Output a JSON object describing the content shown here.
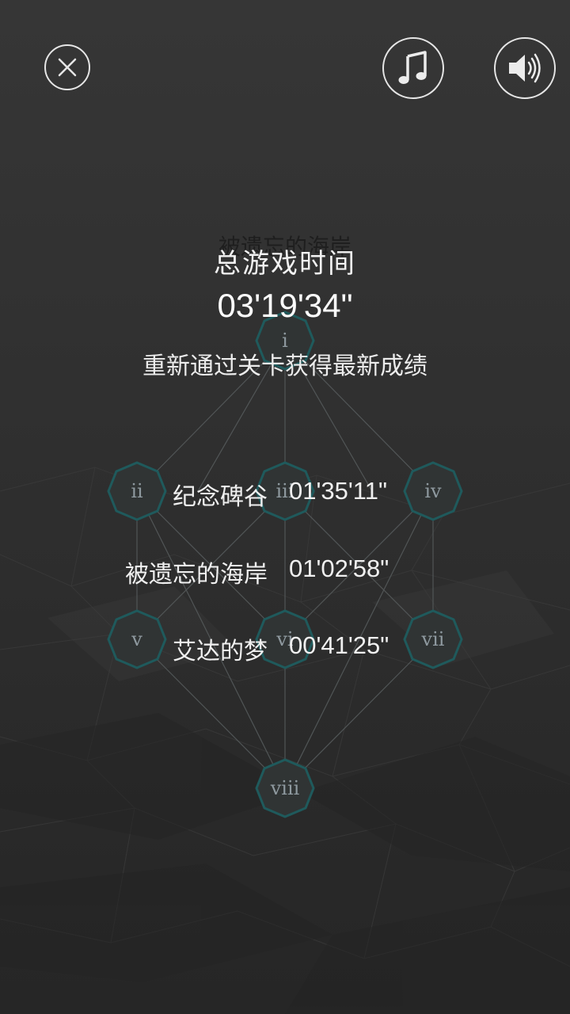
{
  "top_bar": {
    "close_icon": "close-circle-icon",
    "music_icon": "music-note-icon",
    "sound_icon": "speaker-volume-icon"
  },
  "level_map": {
    "ghost_title": "被遗忘的海岸",
    "nodes": [
      "i",
      "ii",
      "iii",
      "iv",
      "v",
      "vi",
      "vii",
      "viii"
    ],
    "node_accent": "#1f5a5c"
  },
  "summary": {
    "title": "总游戏时间",
    "total_time": "03'19'34\"",
    "hint": "重新通过关卡获得最新成绩",
    "levels": [
      {
        "name": "纪念碑谷",
        "time": "01'35'11\""
      },
      {
        "name": "被遗忘的海岸",
        "time": "01'02'58\""
      },
      {
        "name": "艾达的梦",
        "time": "00'41'25\""
      }
    ]
  }
}
